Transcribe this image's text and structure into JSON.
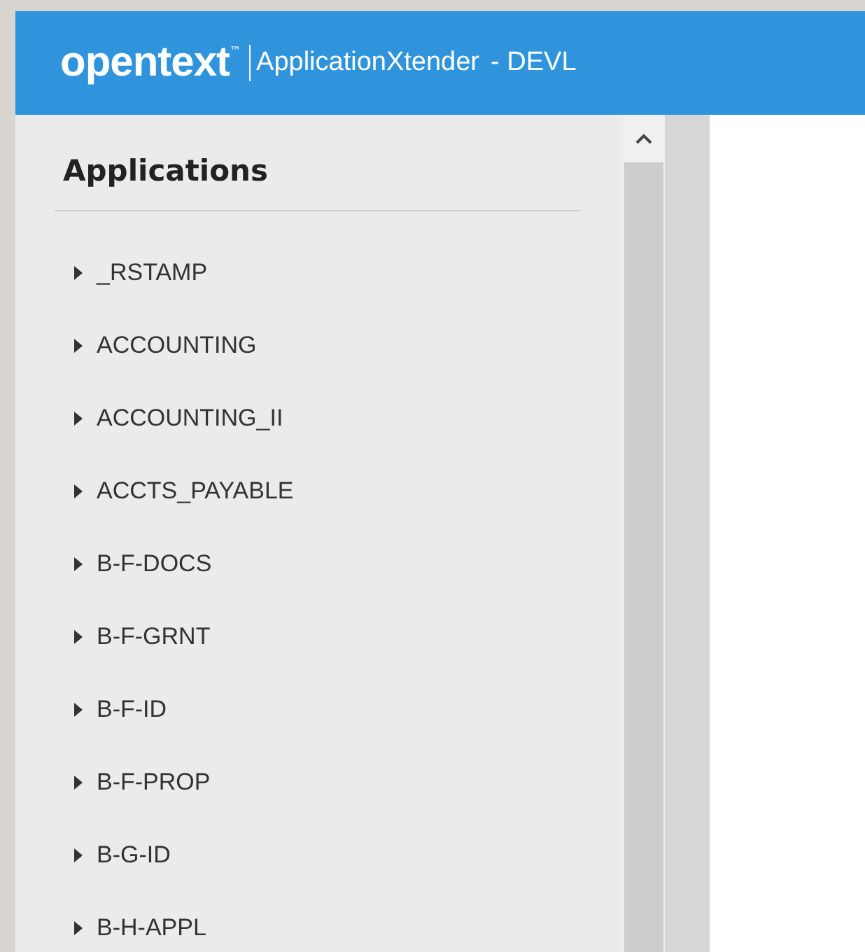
{
  "header": {
    "logo": "opentext",
    "trademark": "™",
    "product": "ApplicationXtender",
    "environment": "- DEVL"
  },
  "sidebar": {
    "title": "Applications",
    "items": [
      {
        "label": "_RSTAMP",
        "expanded": false
      },
      {
        "label": "ACCOUNTING",
        "expanded": false
      },
      {
        "label": "ACCOUNTING_II",
        "expanded": false
      },
      {
        "label": "ACCTS_PAYABLE",
        "expanded": false
      },
      {
        "label": "B-F-DOCS",
        "expanded": false
      },
      {
        "label": "B-F-GRNT",
        "expanded": false
      },
      {
        "label": "B-F-ID",
        "expanded": false
      },
      {
        "label": "B-F-PROP",
        "expanded": false
      },
      {
        "label": "B-G-ID",
        "expanded": false
      },
      {
        "label": "B-H-APPL",
        "expanded": false
      }
    ]
  }
}
